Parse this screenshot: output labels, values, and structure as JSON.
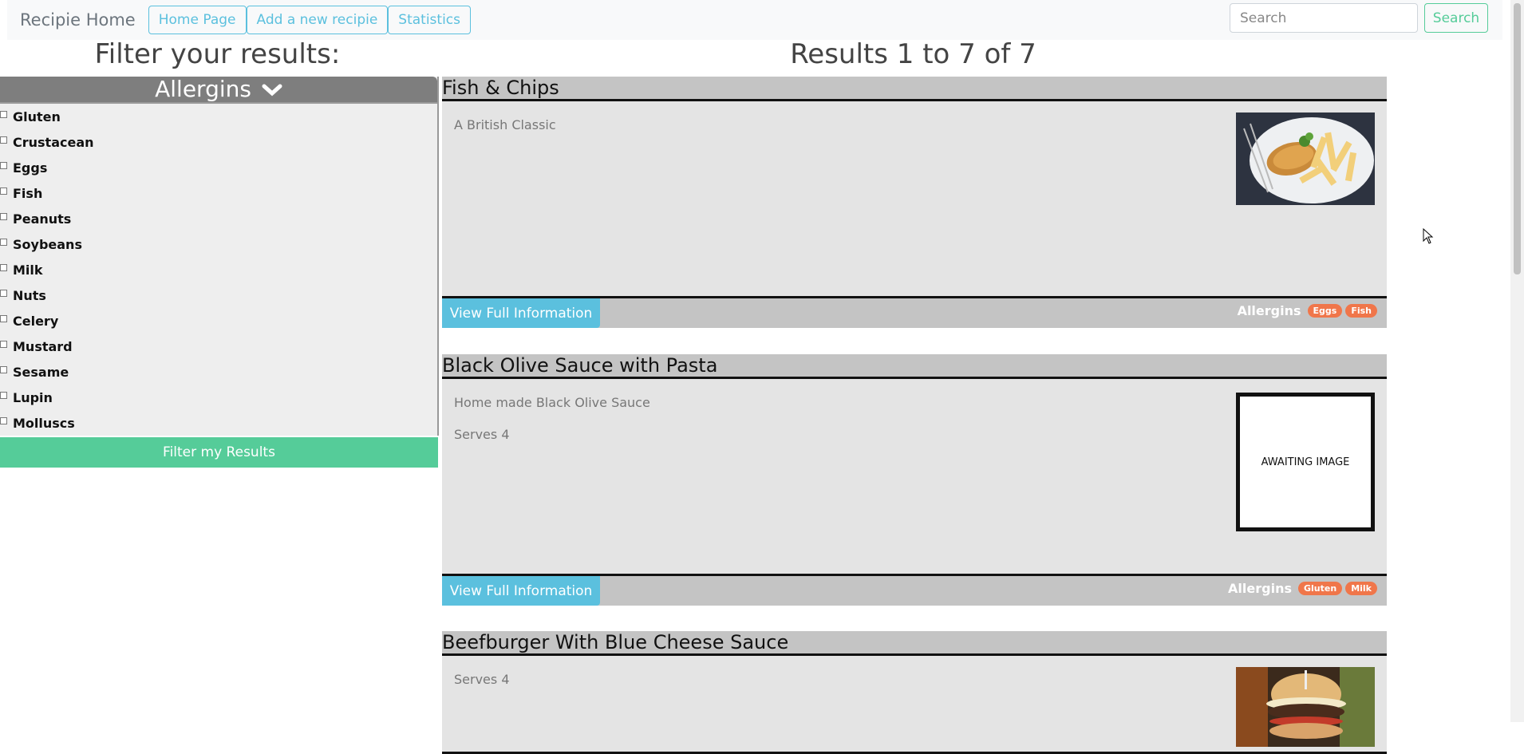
{
  "navbar": {
    "brand": "Recipie Home",
    "links": [
      "Home Page",
      "Add a new recipie",
      "Statistics"
    ],
    "search_placeholder": "Search",
    "search_button": "Search"
  },
  "filter": {
    "title": "Filter your results:",
    "header": "Allergins",
    "allergens": [
      "Gluten",
      "Crustacean",
      "Eggs",
      "Fish",
      "Peanuts",
      "Soybeans",
      "Milk",
      "Nuts",
      "Celery",
      "Mustard",
      "Sesame",
      "Lupin",
      "Molluscs"
    ],
    "button": "Filter my Results"
  },
  "results": {
    "title": "Results 1 to 7 of 7",
    "view_button": "View Full Information",
    "allergins_label": "Allergins",
    "awaiting_image": "AWAITING IMAGE",
    "cards": [
      {
        "title": "Fish & Chips",
        "lines": [
          "A British Classic"
        ],
        "allergens": [
          "Eggs",
          "Fish"
        ],
        "image": "fish-and-chips"
      },
      {
        "title": "Black Olive Sauce with Pasta",
        "lines": [
          "Home made Black Olive Sauce",
          "Serves 4"
        ],
        "allergens": [
          "Gluten",
          "Milk"
        ],
        "image": "awaiting"
      },
      {
        "title": "Beefburger With Blue Cheese Sauce",
        "lines": [
          "Serves 4"
        ],
        "allergens": [],
        "image": "burger"
      }
    ]
  },
  "colors": {
    "accent_info": "#5bc0de",
    "accent_success": "#55cc99",
    "tag": "#f0764a"
  }
}
